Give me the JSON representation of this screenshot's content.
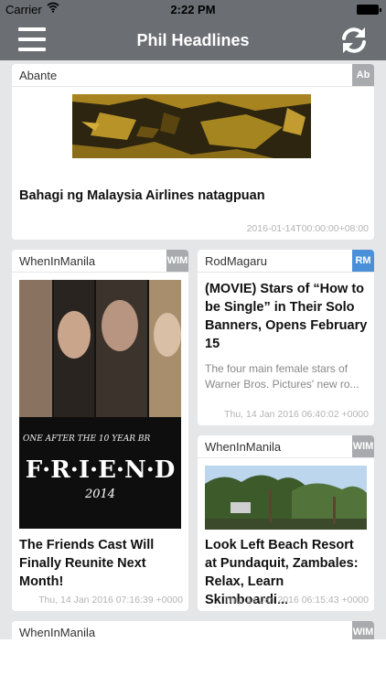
{
  "status_bar": {
    "carrier": "Carrier",
    "time": "2:22 PM"
  },
  "nav": {
    "title": "Phil Headlines",
    "menu_icon": "hamburger-menu-icon",
    "refresh_icon": "refresh-icon"
  },
  "colors": {
    "bar": "#6b6e72",
    "background": "#e4e6e8",
    "badge_gray": "#a8aaad",
    "badge_blue": "#4a90d9"
  },
  "cards": [
    {
      "source": "Abante",
      "badge": "Ab",
      "headline": "Bahagi ng Malaysia Airlines natagpuan",
      "date": "2016-01-14T00:00:00+08:00"
    },
    {
      "source": "WhenInManila",
      "badge": "WIM",
      "headline": "The Friends Cast Will Finally Reunite Next Month!",
      "date": "Thu, 14 Jan 2016 07:16:39 +0000",
      "image_caption": "ONE AFTER THE 10 YEAR BR",
      "image_word": "F·R·I·E·N·D",
      "image_year": "2014"
    },
    {
      "source": "RodMagaru",
      "badge": "RM",
      "headline": "(MOVIE) Stars of “How to be Single” in Their Solo Banners, Opens February 15",
      "summary": "The four main female stars of Warner Bros. Pictures' new ro...",
      "date": "Thu, 14 Jan 2016 06:40:02 +0000"
    },
    {
      "source": "WhenInManila",
      "badge": "WIM",
      "headline": "Look Left Beach Resort at Pundaquit, Zambales: Relax, Learn Skimboardi...",
      "date": "Thu, 14 Jan 2016 06:15:43 +0000"
    },
    {
      "source": "WhenInManila",
      "badge": "WIM"
    }
  ]
}
